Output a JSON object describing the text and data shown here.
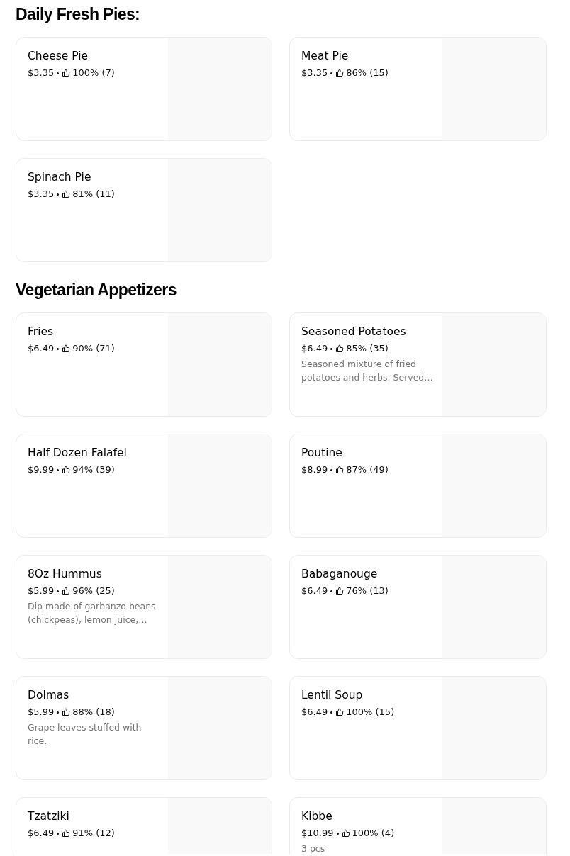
{
  "sections": [
    {
      "title": "Daily Fresh Pies:",
      "items": [
        {
          "name": "Cheese Pie",
          "price": "$3.35",
          "rating": "100% (7)"
        },
        {
          "name": "Meat Pie",
          "price": "$3.35",
          "rating": "86% (15)"
        },
        {
          "name": "Spinach Pie",
          "price": "$3.35",
          "rating": "81% (11)"
        }
      ]
    },
    {
      "title": "Vegetarian Appetizers",
      "items": [
        {
          "name": "Fries",
          "price": "$6.49",
          "rating": "90% (71)"
        },
        {
          "name": "Seasoned Potatoes",
          "price": "$6.49",
          "rating": "85% (35)",
          "description": "Seasoned mixture of fried potatoes and herbs. Served…"
        },
        {
          "name": "Half Dozen Falafel",
          "price": "$9.99",
          "rating": "94% (39)"
        },
        {
          "name": "Poutine",
          "price": "$8.99",
          "rating": "87% (49)"
        },
        {
          "name": "8Oz Hummus",
          "price": "$5.99",
          "rating": "96% (25)",
          "description": "Dip made of garbanzo beans (chickpeas), lemon juice,…"
        },
        {
          "name": "Babaganouge",
          "price": "$6.49",
          "rating": "76% (13)"
        },
        {
          "name": "Dolmas",
          "price": "$5.99",
          "rating": "88% (18)",
          "description": "Grape leaves stuffed with rice."
        },
        {
          "name": "Lentil Soup",
          "price": "$6.49",
          "rating": "100% (15)"
        },
        {
          "name": "Tzatziki",
          "price": "$6.49",
          "rating": "91% (12)"
        },
        {
          "name": "Kibbe",
          "price": "$10.99",
          "rating": "100% (4)",
          "description": "3 pcs"
        }
      ]
    }
  ]
}
